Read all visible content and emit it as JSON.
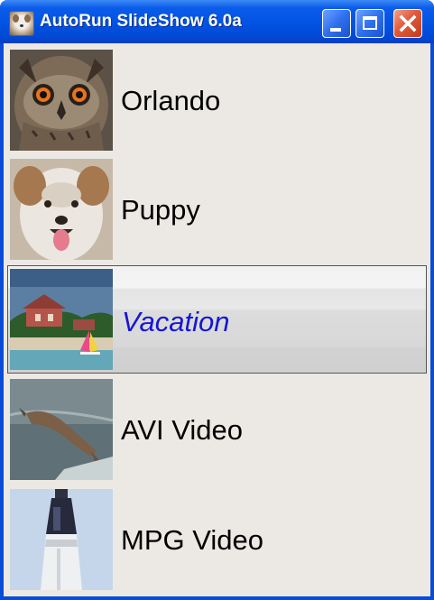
{
  "window": {
    "title": "AutoRun SlideShow 6.0a",
    "app_icon": "dog-icon",
    "controls": [
      "minimize-icon",
      "maximize-icon",
      "close-icon"
    ]
  },
  "slides": [
    {
      "label": "Orlando",
      "thumbnail": "owl-photo",
      "selected": false
    },
    {
      "label": "Puppy",
      "thumbnail": "puppy-photo",
      "selected": false
    },
    {
      "label": "Vacation",
      "thumbnail": "beach-resort-photo",
      "selected": true
    },
    {
      "label": "AVI Video",
      "thumbnail": "leaping-dog-video-frame",
      "selected": false
    },
    {
      "label": "MPG Video",
      "thumbnail": "rocket-launch-video-frame",
      "selected": false
    }
  ],
  "colors": {
    "titlebar": "#0354e4",
    "selected_label": "#1515d8",
    "list_background": "#ece9e4",
    "close_button": "#e05a38"
  }
}
